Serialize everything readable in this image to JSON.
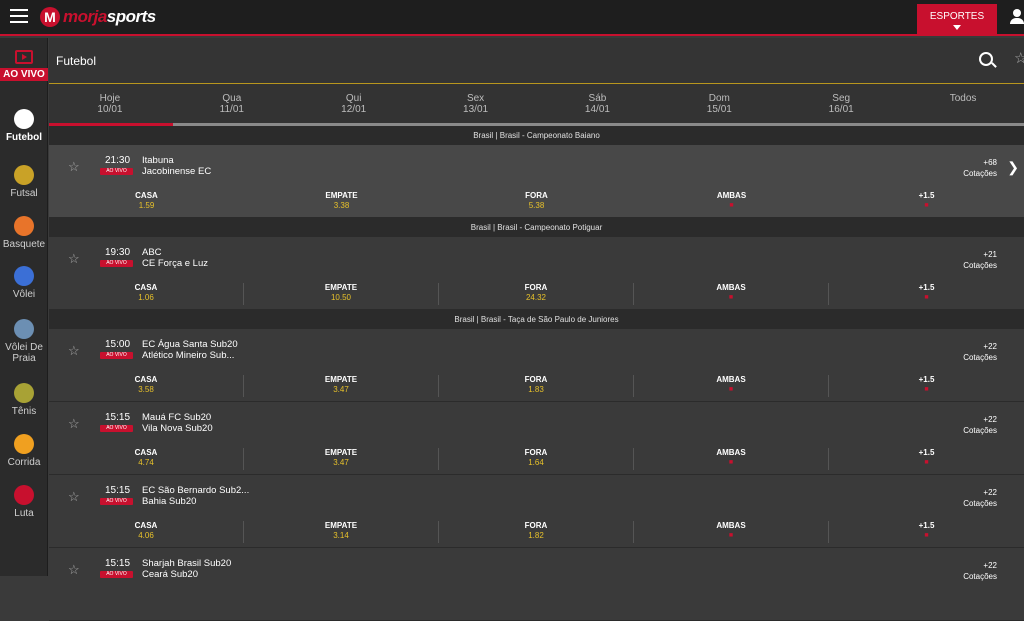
{
  "header": {
    "logo_a": "morja",
    "logo_b": "sports",
    "esportes": "ESPORTES"
  },
  "sidebar": {
    "live": "AO VIVO",
    "items": [
      {
        "label": "Futebol",
        "icon": "soccer-ball-icon",
        "color": "#ffffff"
      },
      {
        "label": "Futsal",
        "icon": "futsal-icon",
        "color": "#c9a227"
      },
      {
        "label": "Basquete",
        "icon": "basketball-icon",
        "color": "#e8742a"
      },
      {
        "label": "Vôlei",
        "icon": "volleyball-icon",
        "color": "#3b6fd6"
      },
      {
        "label": "Vôlei De Praia",
        "icon": "beach-volleyball-icon",
        "color": "#6c8fb3"
      },
      {
        "label": "Tênis",
        "icon": "tennis-ball-icon",
        "color": "#a8a235"
      },
      {
        "label": "Corrida",
        "icon": "racing-helmet-icon",
        "color": "#f0a020"
      },
      {
        "label": "Luta",
        "icon": "boxing-glove-icon",
        "color": "#c8102e"
      }
    ]
  },
  "main": {
    "title": "Futebol",
    "tabs": [
      {
        "day": "Hoje",
        "date": "10/01"
      },
      {
        "day": "Qua",
        "date": "11/01"
      },
      {
        "day": "Qui",
        "date": "12/01"
      },
      {
        "day": "Sex",
        "date": "13/01"
      },
      {
        "day": "Sáb",
        "date": "14/01"
      },
      {
        "day": "Dom",
        "date": "15/01"
      },
      {
        "day": "Seg",
        "date": "16/01"
      },
      {
        "day": "Todos",
        "date": ""
      }
    ],
    "odd_labels": [
      "CASA",
      "EMPATE",
      "FORA",
      "AMBAS",
      "+1.5"
    ],
    "live_badge": "AO VIVO",
    "cotacoes": "Cotações",
    "leagues": [
      "Brasil | Brasil - Campeonato Baiano",
      "Brasil | Brasil - Campeonato Potiguar",
      "Brasil | Brasil - Taça de São Paulo de Juniores"
    ],
    "matches": [
      {
        "time": "21:30",
        "home": "Itabuna",
        "away": "Jacobinense EC",
        "more": "+68",
        "odds": [
          "1.59",
          "3.38",
          "5.38"
        ]
      },
      {
        "time": "19:30",
        "home": "ABC",
        "away": "CE Força e Luz",
        "more": "+21",
        "odds": [
          "1.06",
          "10.50",
          "24.32"
        ]
      },
      {
        "time": "15:00",
        "home": "EC Água Santa Sub20",
        "away": "Atlético Mineiro Sub...",
        "more": "+22",
        "odds": [
          "3.58",
          "3.47",
          "1.83"
        ]
      },
      {
        "time": "15:15",
        "home": "Mauá FC Sub20",
        "away": "Vila Nova Sub20",
        "more": "+22",
        "odds": [
          "4.74",
          "3.47",
          "1.64"
        ]
      },
      {
        "time": "15:15",
        "home": "EC São Bernardo Sub2...",
        "away": "Bahia Sub20",
        "more": "+22",
        "odds": [
          "4.06",
          "3.14",
          "1.82"
        ]
      },
      {
        "time": "15:15",
        "home": "Sharjah Brasil Sub20",
        "away": "Ceará Sub20",
        "more": "+22",
        "odds": [
          "",
          "",
          ""
        ]
      }
    ]
  }
}
